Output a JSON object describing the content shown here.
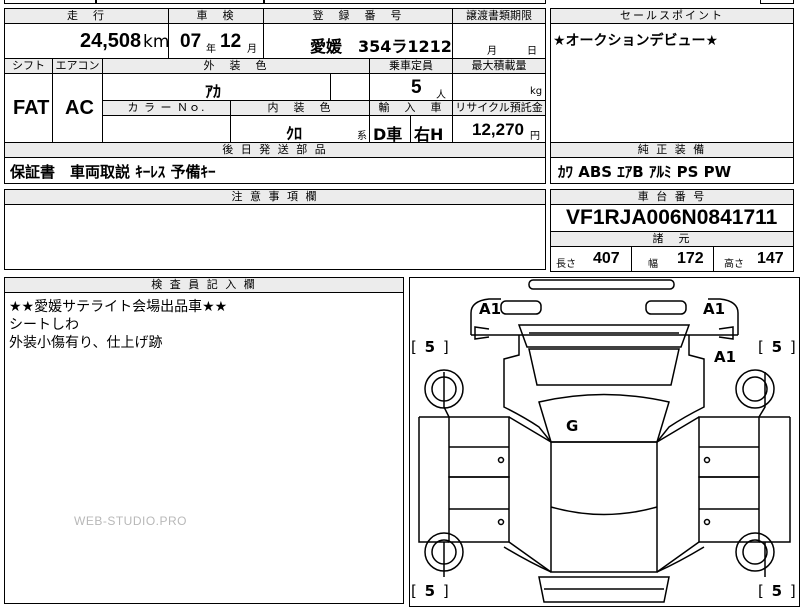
{
  "headers": {
    "mileage": "走　行",
    "inspection": "車　検",
    "registration": "登　録　番　号",
    "transfer_deadline": "譲渡書類期限",
    "sales_point": "セールスポイント",
    "shift": "シフト",
    "aircon": "エアコン",
    "exterior_color": "外　装　色",
    "capacity": "乗車定員",
    "max_load": "最大積載量",
    "color_no": "カ ラ ー Ｎｏ.",
    "interior_color": "内　装　色",
    "import_car": "輸　入　車",
    "recycle_fee": "リサイクル預託金",
    "later_parts": "後 日 発 送 部 品",
    "standard_equipment": "純 正 装 備",
    "notes": "注 意 事 項 欄",
    "chassis_number": "車 台 番 号",
    "specs": "諸　元",
    "inspector_notes": "検 査 員 記 入 欄"
  },
  "vehicle": {
    "mileage_value": "24,508",
    "mileage_unit": "km",
    "inspection_year": "07",
    "year_unit": "年",
    "inspection_month": "12",
    "month_unit": "月",
    "registration_number": "愛媛　354ラ1212",
    "transfer_month_unit": "月",
    "transfer_day_unit": "日",
    "shift": "FAT",
    "aircon": "AC",
    "exterior_color": "ｱｶ",
    "capacity": "5",
    "capacity_unit": "人",
    "load_unit": "kg",
    "interior_color": "ｸﾛ",
    "interior_suffix": "系",
    "import_type": "D車",
    "steering": "右H",
    "recycle_fee": "12,270",
    "recycle_unit": "円",
    "chassis_number": "VF1RJA006N0841711",
    "length_label": "長さ",
    "length": "407",
    "width_label": "幅",
    "width": "172",
    "height_label": "高さ",
    "height": "147"
  },
  "sales_point_text": "★オークションデビュー★",
  "later_parts_text": "保証書　車両取説 ｷｰﾚｽ 予備ｷｰ",
  "standard_equipment_text": "ｶﾜ ABS ｴｱB ｱﾙﾐ PS PW",
  "inspector_lines": [
    "★★愛媛サテライト会場出品車★★",
    "シートしわ",
    "外装小傷有り、仕上げ跡"
  ],
  "watermark": "WEB-STUDIO.PRO",
  "diagram": {
    "marks": {
      "front_left": "A1",
      "front_right": "A1",
      "right_fender": "A1",
      "roof": "G"
    },
    "tires": {
      "front_left": "5",
      "front_right": "5",
      "rear_left": "5",
      "rear_right": "5"
    }
  }
}
